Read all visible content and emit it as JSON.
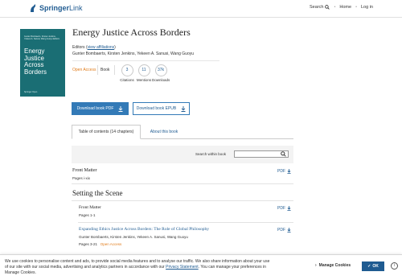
{
  "header": {
    "logo_bold": "Springer",
    "logo_light": "Link",
    "search_label": "Search",
    "home_label": "Home",
    "login_label": "Log in",
    "sep": "•"
  },
  "cover": {
    "editors": "Gunter Bombaerts, Kirsten Jenkins, Yekeen A. Sanusi, Wang Guoyu",
    "editors_suffix": "Editors",
    "title": "Energy Justice Across Borders",
    "publisher": "Springer Open"
  },
  "book": {
    "title": "Energy Justice Across Borders",
    "editors_label": "Editors",
    "affiliations_link": "view affiliations",
    "editors": "Gunter Bombaerts, Kirsten Jenkins, Yekeen A. Sanusi, Wang Guoyu",
    "open_access": "Open Access",
    "type": "Book"
  },
  "metrics": [
    {
      "value": "3",
      "label": "Citations"
    },
    {
      "value": "11",
      "label": "Mentions"
    },
    {
      "value": "37k",
      "label": "Downloads"
    }
  ],
  "buttons": {
    "download_pdf": "Download book PDF",
    "download_epub": "Download book EPUB"
  },
  "tabs": {
    "toc": "Table of contents (14 chapters)",
    "about": "About this book"
  },
  "search": {
    "label": "Search within book",
    "placeholder": ""
  },
  "toc": {
    "front_matter_top": {
      "title": "Front Matter",
      "pages": "Pages i-xix",
      "pdf": "PDF"
    },
    "part_title": "Setting the Scene",
    "front_matter_part": {
      "title": "Front Matter",
      "pages": "Pages 1-1",
      "pdf": "PDF"
    },
    "chapter1": {
      "title": "Expanding Ethics Justice Across Borders: The Role of Global Philosophy",
      "authors": "Gunter Bombaerts, Kirsten Jenkins, Yekeen A. Sanusi, Wang Guoyu",
      "pages": "Pages 3-21",
      "open_access": "Open Access",
      "pdf": "PDF"
    }
  },
  "cookie": {
    "text_before": "We use cookies to personalise content and ads, to provide social media features and to analyse our traffic. We also share information about your use of our site with our social media, advertising and analytics partners in accordance with our ",
    "privacy_link": "Privacy Statement",
    "text_after": ". You can manage your preferences in Manage Cookies.",
    "manage_label": "Manage Cookies",
    "ok_label": "OK",
    "info": "i"
  },
  "colors": {
    "brand": "#1f5b91",
    "button_blue": "#337ab7",
    "cover_teal": "#1a6e74",
    "open_access": "#e07b1a"
  }
}
